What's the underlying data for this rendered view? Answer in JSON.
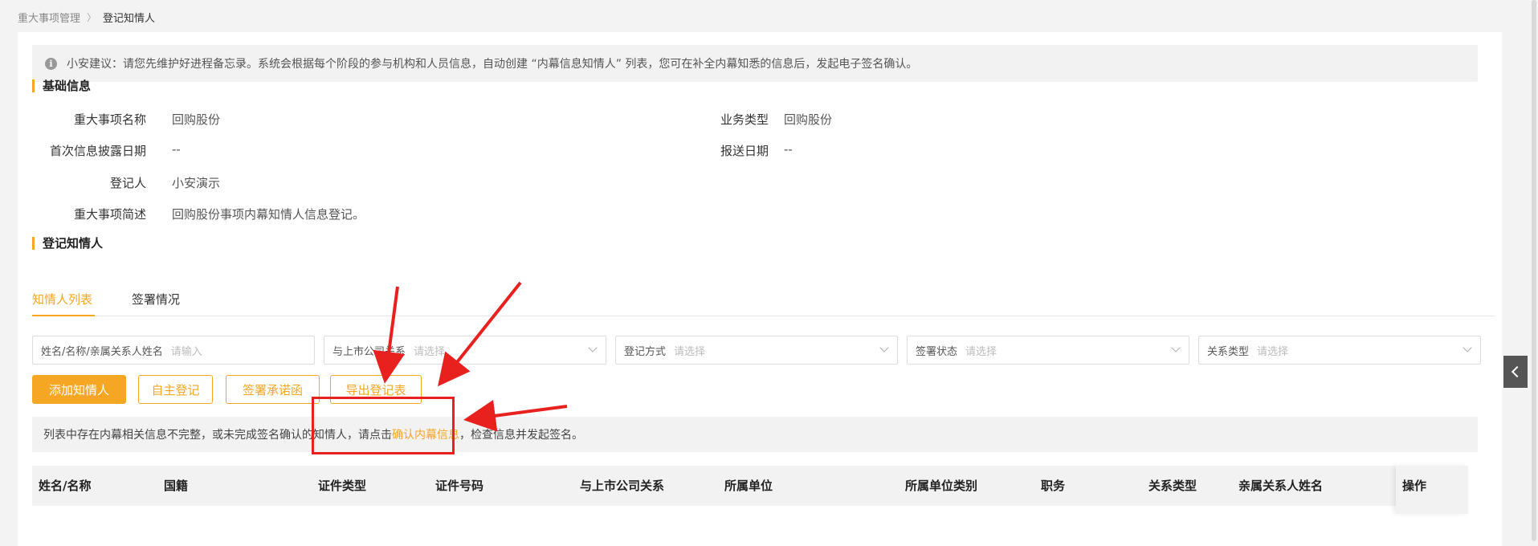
{
  "breadcrumb": {
    "parent": "重大事项管理",
    "separator": "〉",
    "current": "登记知情人"
  },
  "tip": {
    "icon": "info-icon",
    "text": "小安建议：请您先维护好进程备忘录。系统会根据每个阶段的参与机构和人员信息，自动创建 “内幕信息知情人” 列表，您可在补全内幕知悉的信息后，发起电子签名确认。"
  },
  "basic": {
    "title": "基础信息",
    "fields": [
      {
        "label": "重大事项名称",
        "value": "回购股份"
      },
      {
        "label": "业务类型",
        "value": "回购股份"
      },
      {
        "label": "首次信息披露日期",
        "value": "--"
      },
      {
        "label": "报送日期",
        "value": "--"
      },
      {
        "label": "登记人",
        "value": "小安演示"
      },
      {
        "label": "重大事项简述",
        "value": "回购股份事项内幕知情人信息登记。"
      }
    ]
  },
  "register": {
    "title": "登记知情人"
  },
  "tabs": [
    {
      "label": "知情人列表",
      "active": true
    },
    {
      "label": "签署情况",
      "active": false
    }
  ],
  "filters": [
    {
      "label": "姓名/名称/亲属关系人姓名",
      "placeholder": "请输入",
      "type": "input"
    },
    {
      "label": "与上市公司关系",
      "placeholder": "请选择",
      "type": "select"
    },
    {
      "label": "登记方式",
      "placeholder": "请选择",
      "type": "select"
    },
    {
      "label": "签署状态",
      "placeholder": "请选择",
      "type": "select"
    },
    {
      "label": "关系类型",
      "placeholder": "请选择",
      "type": "select"
    }
  ],
  "buttons": [
    {
      "label": "添加知情人",
      "primary": true
    },
    {
      "label": "自主登记",
      "primary": false
    },
    {
      "label": "签署承诺函",
      "primary": false
    },
    {
      "label": "导出登记表",
      "primary": false
    }
  ],
  "notice": {
    "before": "列表中存在内幕相关信息不完整，或未完成签名确认的知情人，请点击",
    "link": "确认内幕信息",
    "after": "，检查信息并发起签名。"
  },
  "table": {
    "columns": [
      "姓名/名称",
      "国籍",
      "证件类型",
      "证件号码",
      "与上市公司关系",
      "所属单位",
      "所属单位类别",
      "职务",
      "关系类型",
      "亲属关系人姓名",
      "操作"
    ]
  },
  "colors": {
    "accent": "#f5a623",
    "annotation": "#e8201e"
  }
}
